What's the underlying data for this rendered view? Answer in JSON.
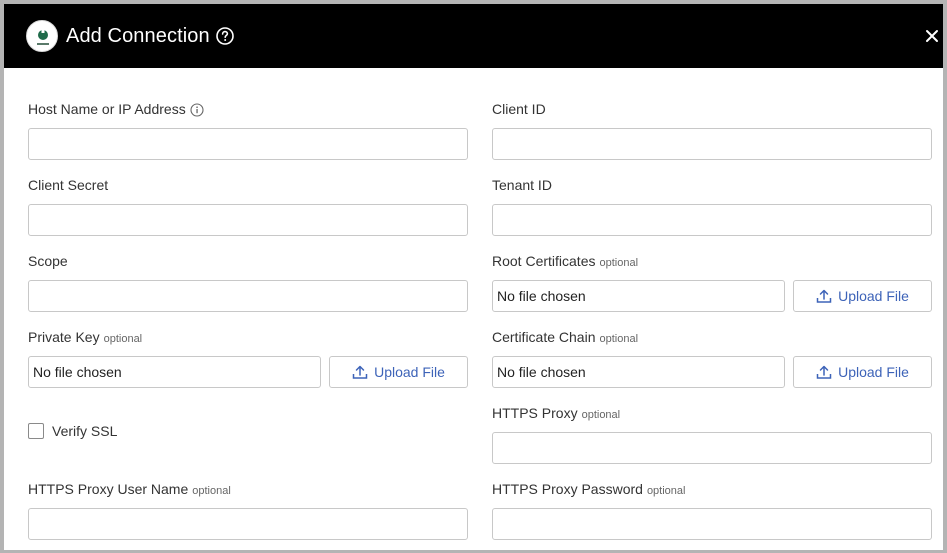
{
  "dialog": {
    "title": "Add Connection",
    "icons": {
      "logo": "brand-logo-icon",
      "help": "help-circle-icon",
      "close": "close-icon",
      "info": "info-circle-icon",
      "upload": "upload-icon"
    },
    "colors": {
      "header_bg": "#000000",
      "link_blue": "#3d63b8"
    }
  },
  "fields": {
    "host": {
      "label": "Host Name or IP Address",
      "value": ""
    },
    "client_id": {
      "label": "Client ID",
      "value": ""
    },
    "client_secret": {
      "label": "Client Secret",
      "value": ""
    },
    "tenant_id": {
      "label": "Tenant ID",
      "value": ""
    },
    "scope": {
      "label": "Scope",
      "value": ""
    },
    "root_certificates": {
      "label": "Root Certificates",
      "optional": "optional",
      "file": "No file chosen",
      "button": "Upload File"
    },
    "private_key": {
      "label": "Private Key",
      "optional": "optional",
      "file": "No file chosen",
      "button": "Upload File"
    },
    "certificate_chain": {
      "label": "Certificate Chain",
      "optional": "optional",
      "file": "No file chosen",
      "button": "Upload File"
    },
    "verify_ssl": {
      "label": "Verify SSL",
      "checked": false
    },
    "https_proxy": {
      "label": "HTTPS Proxy",
      "optional": "optional",
      "value": ""
    },
    "proxy_user": {
      "label": "HTTPS Proxy User Name",
      "optional": "optional",
      "value": ""
    },
    "proxy_password": {
      "label": "HTTPS Proxy Password",
      "optional": "optional",
      "value": ""
    }
  }
}
